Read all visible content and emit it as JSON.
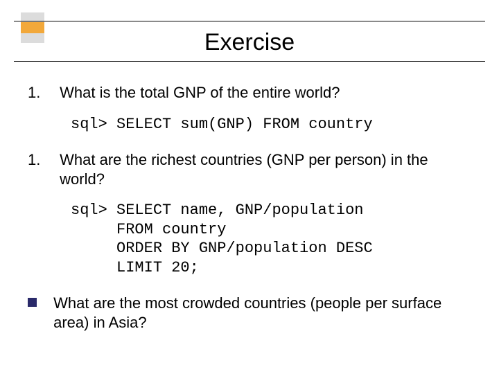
{
  "title": "Exercise",
  "items": [
    {
      "marker": "1.",
      "question": "What is the total GNP of the entire world?",
      "code": "sql> SELECT sum(GNP) FROM country"
    },
    {
      "marker": "1.",
      "question": "What are the richest countries (GNP per person) in the world?",
      "code": "sql> SELECT name, GNP/population\n     FROM country\n     ORDER BY GNP/population DESC\n     LIMIT 20;"
    }
  ],
  "bullet": {
    "text": "What are the most crowded countries (people per surface area) in Asia?"
  }
}
